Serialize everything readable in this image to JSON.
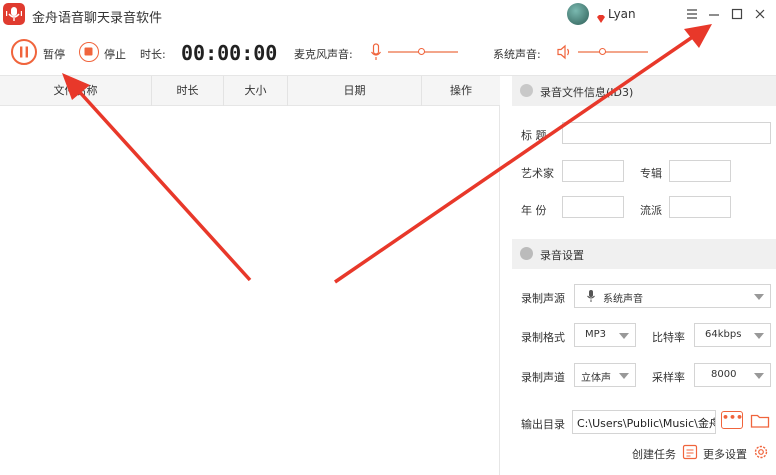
{
  "window": {
    "title": "金舟语音聊天录音软件",
    "username": "Lyan"
  },
  "toolbar": {
    "pause_label": "暂停",
    "stop_label": "停止",
    "duration_label": "时长:",
    "duration_value": "00:00:00",
    "mic_label": "麦克风声音:",
    "mic_level": 0.48,
    "system_label": "系统声音:",
    "system_level": 0.35
  },
  "file_list": {
    "columns": [
      "文件名称",
      "时长",
      "大小",
      "日期",
      "操作"
    ],
    "rows": []
  },
  "id3": {
    "section_title": "录音文件信息(ID3)",
    "title_label": "标 题",
    "artist_label": "艺术家",
    "album_label": "专辑",
    "year_label": "年 份",
    "genre_label": "流派",
    "title_value": "",
    "artist_value": "",
    "album_value": "",
    "year_value": "",
    "genre_value": ""
  },
  "settings": {
    "section_title": "录音设置",
    "source_label": "录制声源",
    "source_value": "系统声音",
    "format_label": "录制格式",
    "format_value": "MP3",
    "bitrate_label": "比特率",
    "bitrate_value": "64kbps",
    "channel_label": "录制声道",
    "channel_value": "立体声",
    "samplerate_label": "采样率",
    "samplerate_value": "8000",
    "output_label": "输出目录",
    "output_value": "C:\\Users\\Public\\Music\\金舟",
    "browse_label": "•••"
  },
  "footer": {
    "create_task_label": "创建任务",
    "more_settings_label": "更多设置"
  },
  "colors": {
    "accent": "#f0643c",
    "arrow": "#e8382a",
    "logo": "#e03b2f"
  }
}
